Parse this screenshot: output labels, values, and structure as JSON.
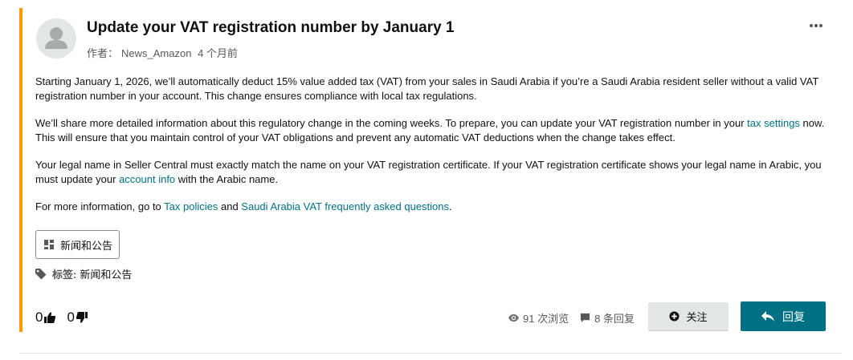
{
  "post": {
    "title": "Update your VAT registration number by January 1",
    "author_prefix": "作者：",
    "author": "News_Amazon",
    "time_ago": "4 个月前",
    "accent_color": "#ff9900",
    "body": {
      "p1": "Starting January 1, 2026, we’ll automatically deduct 15% value added tax (VAT) from your sales in Saudi Arabia if you’re a Saudi Arabia resident seller without a valid VAT registration number in your account. This change ensures compliance with local tax regulations.",
      "p2_before": "We’ll share more detailed information about this regulatory change in the coming weeks. To prepare, you can update your VAT registration number in your ",
      "p2_link": "tax settings",
      "p2_after": " now. This will ensure that you maintain control of your VAT obligations and prevent any automatic VAT deductions when the change takes effect.",
      "p3_before": "Your legal name in Seller Central must exactly match the name on your VAT registration certificate. If your VAT registration certificate shows your legal name in Arabic, you must update your ",
      "p3_link": "account info",
      "p3_after": " with the Arabic name.",
      "p4_before": "For more information, go to ",
      "p4_link1": "Tax policies",
      "p4_mid": " and ",
      "p4_link2": "Saudi Arabia VAT frequently asked questions",
      "p4_after": "."
    },
    "category_label": "新闻和公告",
    "tags_label": "标签:",
    "tag_value": "新闻和公告",
    "upvotes": "0",
    "downvotes": "0",
    "views": "91 次浏览",
    "replies": "8 条回复",
    "follow_label": "关注",
    "reply_label": "回复",
    "link_color": "#007185",
    "reply_button_color": "#007185"
  },
  "icons": {
    "avatar": "user-avatar-icon",
    "more": "more-options-icon",
    "category": "dashboard-grid-icon",
    "tag": "tag-icon",
    "upvote": "thumbs-up-icon",
    "downvote": "thumbs-down-icon",
    "views": "eye-icon",
    "replies": "comment-icon",
    "follow": "plus-circle-icon",
    "reply": "reply-arrow-icon"
  }
}
